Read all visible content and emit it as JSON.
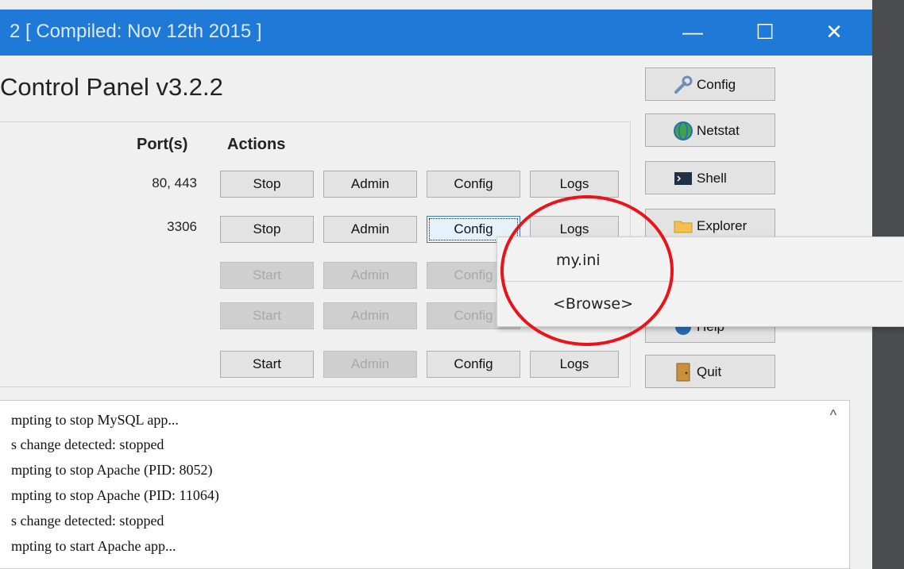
{
  "window": {
    "title": "2  [ Compiled: Nov 12th 2015 ]",
    "minimize_glyph": "—",
    "maximize_glyph": "☐",
    "close_glyph": "✕"
  },
  "app": {
    "heading": "Control Panel v3.2.2"
  },
  "columns": {
    "ports": "Port(s)",
    "actions": "Actions"
  },
  "rows": [
    {
      "port": "80, 443",
      "start_stop": "Stop",
      "admin": "Admin",
      "config": "Config",
      "logs": "Logs",
      "enabled": true
    },
    {
      "port": "3306",
      "start_stop": "Stop",
      "admin": "Admin",
      "config": "Config",
      "logs": "Logs",
      "enabled": true
    },
    {
      "port": "",
      "start_stop": "Start",
      "admin": "Admin",
      "config": "Config",
      "logs": "",
      "enabled": false
    },
    {
      "port": "",
      "start_stop": "Start",
      "admin": "Admin",
      "config": "Config",
      "logs": "",
      "enabled": false
    },
    {
      "port": "",
      "start_stop": "Start",
      "admin": "Admin",
      "config": "Config",
      "logs": "Logs",
      "enabled": true
    }
  ],
  "side_buttons": {
    "config": "Config",
    "netstat": "Netstat",
    "shell": "Shell",
    "explorer": "Explorer",
    "help": "Help",
    "quit": "Quit"
  },
  "context_menu": {
    "items": [
      "my.ini",
      "<Browse>"
    ]
  },
  "log": {
    "lines": [
      "mpting to stop MySQL app...",
      "s change detected: stopped",
      "mpting to stop Apache (PID: 8052)",
      "mpting to stop Apache (PID: 11064)",
      "s change detected: stopped",
      "mpting to start Apache app..."
    ],
    "scroll_glyph": "^"
  },
  "colors": {
    "titlebar": "#1e7ad6",
    "annotation": "#e8141a"
  }
}
